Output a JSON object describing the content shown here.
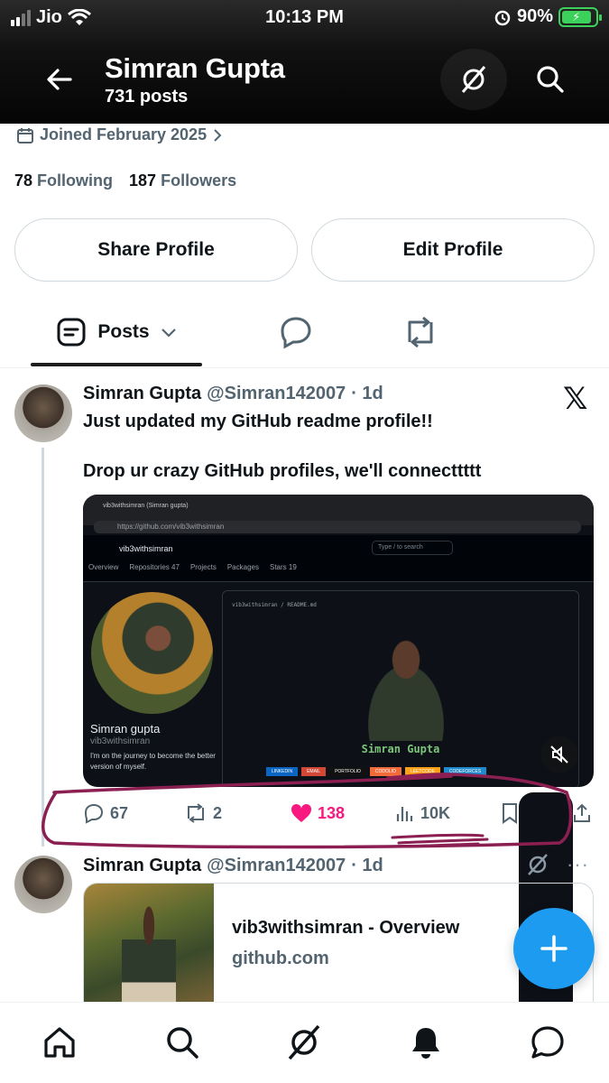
{
  "status_bar": {
    "carrier": "Jio",
    "time": "10:13 PM",
    "battery": "90%"
  },
  "header": {
    "name": "Simran Gupta",
    "post_count": "731 posts"
  },
  "profile": {
    "joined": "Joined February 2025",
    "following_count": "78",
    "following_label": "Following",
    "followers_count": "187",
    "followers_label": "Followers",
    "share_button": "Share Profile",
    "edit_button": "Edit Profile"
  },
  "tabs": {
    "posts_label": "Posts"
  },
  "post": {
    "name": "Simran Gupta",
    "handle": "@Simran142007",
    "time": "· 1d",
    "line1": "Just updated my GitHub readme profile!!",
    "line2": "Drop ur crazy GitHub profiles, we'll connecttttt",
    "media": {
      "tab_title": "vib3withsimran (Simran gupta)",
      "url": "https://github.com/vib3withsimran",
      "username": "vib3withsimran",
      "search_placeholder": "Type / to search",
      "nav": [
        "Overview",
        "Repositories 47",
        "Projects",
        "Packages",
        "Stars 19"
      ],
      "profile_name": "Simran gupta",
      "profile_user": "vib3withsimran",
      "bio": "I'm on the journey to become the better version of myself.",
      "readme_path": "vib3withsimran / README.md",
      "readme_name": "Simran Gupta",
      "badges": [
        "LINKEDIN",
        "EMAIL",
        "PORTFOLIO",
        "CODOLIO",
        "LEETCODE",
        "CODEFORCES"
      ]
    },
    "replies": "67",
    "reposts": "2",
    "likes": "138",
    "views": "10K"
  },
  "post2": {
    "name": "Simran Gupta",
    "handle": "@Simran142007",
    "time": "· 1d",
    "card_title": "vib3withsimran - Overview",
    "card_domain": "github.com"
  },
  "colors": {
    "accent": "#1d9bf0",
    "like": "#f91880",
    "scribble": "#8b1f52"
  }
}
